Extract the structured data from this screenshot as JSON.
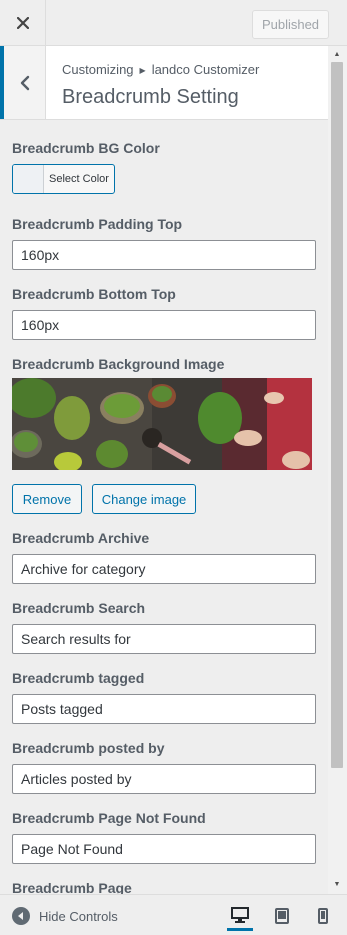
{
  "header": {
    "close_icon": "close-icon",
    "publish_label": "Published"
  },
  "section": {
    "breadcrumb_root": "Customizing",
    "breadcrumb_sep_icon": "triangle-right-icon",
    "breadcrumb_panel": "landco Customizer",
    "title": "Breadcrumb Setting",
    "back_icon": "chevron-left-icon"
  },
  "controls": {
    "bg_color": {
      "label": "Breadcrumb BG Color",
      "button_label": "Select Color",
      "swatch_color": "#eef1f4"
    },
    "padding_top": {
      "label": "Breadcrumb Padding Top",
      "value": "160px"
    },
    "bottom_top": {
      "label": "Breadcrumb Bottom Top",
      "value": "160px"
    },
    "background_image": {
      "label": "Breadcrumb Background Image",
      "remove_label": "Remove",
      "change_label": "Change image"
    },
    "archive": {
      "label": "Breadcrumb Archive",
      "value": "Archive for category"
    },
    "search": {
      "label": "Breadcrumb Search",
      "value": "Search results for"
    },
    "tagged": {
      "label": "Breadcrumb tagged",
      "value": "Posts tagged"
    },
    "posted_by": {
      "label": "Breadcrumb posted by",
      "value": "Articles posted by"
    },
    "not_found": {
      "label": "Breadcrumb Page Not Found",
      "value": "Page Not Found"
    },
    "page": {
      "label": "Breadcrumb Page"
    }
  },
  "footer": {
    "hide_controls_label": "Hide Controls",
    "devices": [
      "desktop-icon",
      "tablet-icon",
      "mobile-icon"
    ],
    "active_device": "desktop"
  },
  "colors": {
    "accent": "#0073aa",
    "panel_bg": "#eeeeee"
  }
}
